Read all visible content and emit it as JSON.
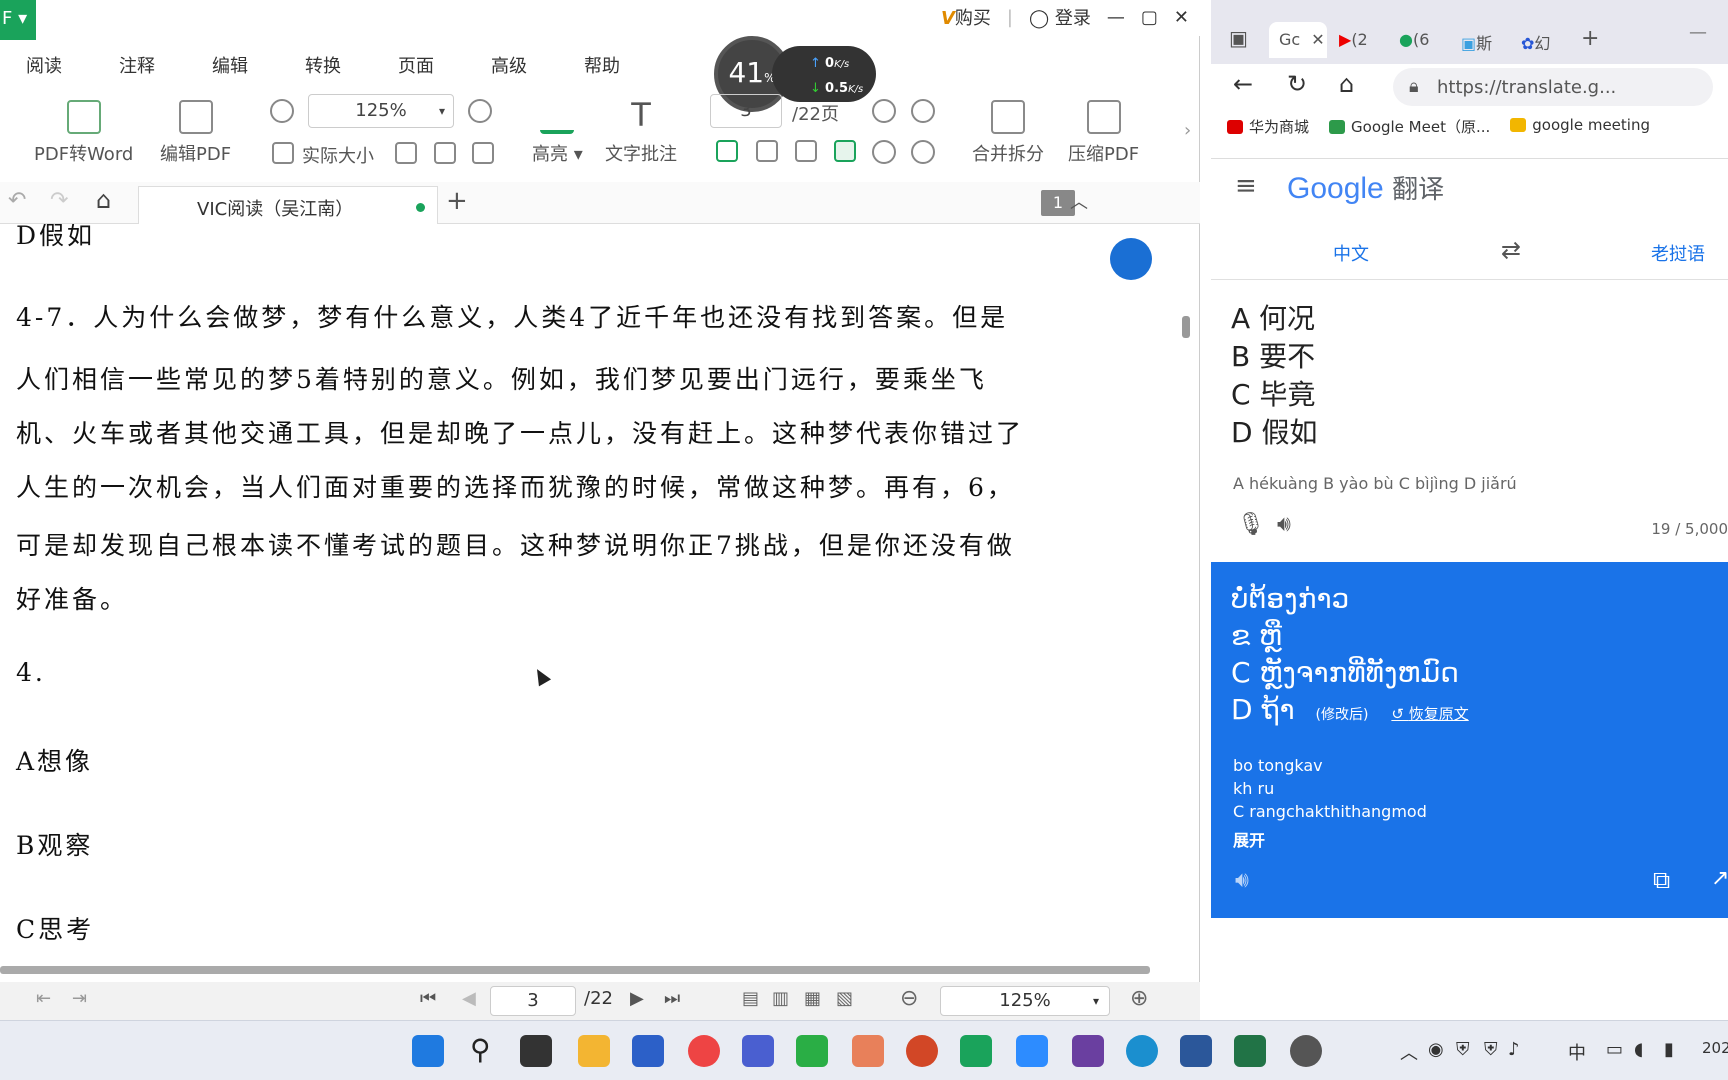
{
  "pdf_reader": {
    "app_badge": "F",
    "top_right": {
      "vip_label": "购买",
      "login_label": "登录"
    },
    "menu": [
      "阅读",
      "注释",
      "编辑",
      "转换",
      "页面",
      "高级",
      "帮助"
    ],
    "toolbar": {
      "pdf_to_word": "PDF转Word",
      "edit_pdf": "编辑PDF",
      "zoom_value": "125%",
      "actual_size": "实际大小",
      "page_current": "3",
      "page_total": "/22页",
      "highlight": "高亮",
      "text_annotation": "文字批注",
      "merge_split": "合并拆分",
      "compress_pdf": "压缩PDF"
    },
    "tab": {
      "title": "VIC阅读（吴江南）",
      "page_badge": "1"
    },
    "content_lines": [
      "D假如",
      "4-7．人为什么会做梦，梦有什么意义，人类4了近千年也还没有找到答案。但是",
      "人们相信一些常见的梦5着特别的意义。例如，我们梦见要出门远行，要乘坐飞",
      "机、火车或者其他交通工具，但是却晚了一点儿，没有赶上。这种梦代表你错过了",
      "人生的一次机会，当人们面对重要的选择而犹豫的时候，常做这种梦。再有，6，",
      "可是却发现自己根本读不懂考试的题目。这种梦说明你正7挑战，但是你还没有做",
      "好准备。",
      "4.",
      "A想像",
      "B观察",
      "C思考"
    ],
    "status": {
      "page_current": "3",
      "page_total": "/22",
      "zoom": "125%"
    }
  },
  "speed_widget": {
    "percent": "41",
    "percent_unit": "%",
    "up": "0",
    "up_unit": "K/s",
    "down": "0.5",
    "down_unit": "K/s"
  },
  "browser": {
    "tabs": [
      "Gc",
      "(2",
      "(6",
      "斯",
      "幻"
    ],
    "url": "https://translate.g...",
    "bookmarks": [
      "华为商城",
      "Google Meet（原...",
      "google meeting"
    ],
    "translate": {
      "logo_google": "Google",
      "logo_suffix": "翻译",
      "source_lang": "中文",
      "target_lang": "老挝语",
      "source_lines": [
        "A 何况",
        "B 要不",
        "C 毕竟",
        "D 假如"
      ],
      "source_romanization": "A hékuàng B yào bù C bìjìng D jiǎrú",
      "char_count": "19 / 5,000",
      "result_lines": [
        "ບໍ່ຕ້ອງກ່າວ",
        "ຂ ຫຼື",
        "C ຫຼັງຈາກທີ່ທັງຫມົດ",
        "D ຖ້າ"
      ],
      "modified_label": "(修改后)",
      "restore_label": "恢复原文",
      "result_romanization": [
        "bo tongkav",
        "kh ru",
        "C  rangchakthithangmod"
      ],
      "expand_label": "展开"
    }
  },
  "taskbar": {
    "tray_ime": "中",
    "clock_fragment": "202"
  }
}
